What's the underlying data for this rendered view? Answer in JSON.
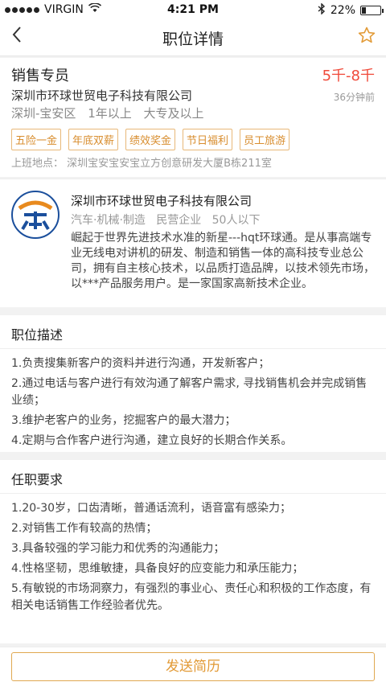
{
  "status_bar": {
    "carrier": "VIRGIN",
    "time": "4:21 PM",
    "battery": "22%",
    "battery_level": 0.22
  },
  "nav": {
    "title": "职位详情"
  },
  "job": {
    "title": "销售专员",
    "salary": "5千-8千",
    "company": "深圳市环球世贸电子科技有限公司",
    "posted": "36分钟前",
    "location": "深圳-宝安区",
    "experience": "1年以上",
    "education": "大专及以上",
    "benefits": [
      "五险一金",
      "年底双薪",
      "绩效奖金",
      "节日福利",
      "员工旅游"
    ],
    "address": "上班地点：  深圳宝安宝安宝立方创意研发大厦B栋211室"
  },
  "company": {
    "name": "深圳市环球世贸电子科技有限公司",
    "industry": "汽车·机械·制造",
    "type": "民营企业",
    "size": "50人以下",
    "description": "崛起于世界先进技术水准的新星---hqt环球通。是从事高端专业无线电对讲机的研发、制造和销售一体的高科技专业总公司，拥有自主核心技术，以品质打造品牌，以技术领先市场，以***产品服务用户。是一家国家高新技术企业。"
  },
  "job_description": {
    "heading": "职位描述",
    "items": [
      "1.负责搜集新客户的资料并进行沟通，开发新客户；",
      "2.通过电话与客户进行有效沟通了解客户需求, 寻找销售机会并完成销售业绩；",
      "3.维护老客户的业务，挖掘客户的最大潜力；",
      "4.定期与合作客户进行沟通，建立良好的长期合作关系。"
    ]
  },
  "requirements": {
    "heading": "任职要求",
    "items": [
      "1.20-30岁，口齿清晰，普通话流利，语音富有感染力；",
      "2.对销售工作有较高的热情；",
      "3.具备较强的学习能力和优秀的沟通能力；",
      "4.性格坚韧，思维敏捷，具备良好的应变能力和承压能力；",
      "5.有敏锐的市场洞察力，有强烈的事业心、责任心和积极的工作态度，有相关电话销售工作经验者优先。"
    ]
  },
  "actions": {
    "send_resume": "发送简历"
  },
  "colors": {
    "salary": "#f04a3a",
    "accent": "#e29a36",
    "tag_border": "#e8b878"
  }
}
